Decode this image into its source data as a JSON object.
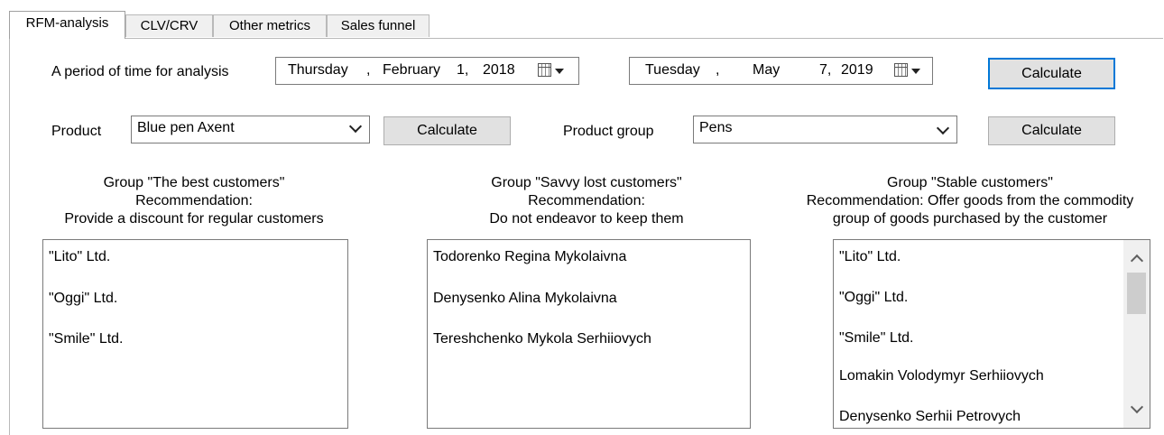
{
  "tabs": [
    {
      "label": "RFM-analysis",
      "active": true
    },
    {
      "label": "CLV/CRV",
      "active": false
    },
    {
      "label": "Other metrics",
      "active": false
    },
    {
      "label": "Sales funnel",
      "active": false
    }
  ],
  "period": {
    "label": "A period of time for analysis",
    "from": {
      "weekday": "Thursday",
      "sep": ",",
      "month": "February",
      "day": "1,",
      "year": "2018"
    },
    "to": {
      "weekday": "Tuesday",
      "sep": ",",
      "month": "May",
      "day": "7,",
      "year": "2019"
    },
    "calculate_label": "Calculate"
  },
  "product": {
    "label": "Product",
    "value": "Blue pen Axent",
    "calculate_label": "Calculate"
  },
  "product_group": {
    "label": "Product group",
    "value": "Pens",
    "calculate_label": "Calculate"
  },
  "groups": [
    {
      "line1": "Group \"The best customers\"",
      "line2": "Recommendation:",
      "line3": "Provide a discount for regular customers",
      "items": [
        "\"Lito\" Ltd.",
        "\"Oggi\" Ltd.",
        "\"Smile\" Ltd."
      ]
    },
    {
      "line1": "Group \"Savvy lost customers\"",
      "line2": "Recommendation:",
      "line3": "Do not endeavor to keep them",
      "items": [
        "Todorenko Regina Mykolaivna",
        "Denysenko Alina Mykolaivna",
        "Tereshchenko Mykola Serhiiovych"
      ]
    },
    {
      "line1": "Group \"Stable customers\"",
      "line2": "Recommendation: Offer goods from the commodity",
      "line3": "group of goods purchased by the customer",
      "items": [
        "\"Lito\" Ltd.",
        "\"Oggi\" Ltd.",
        "\"Smile\" Ltd.",
        "Lomakin Volodymyr Serhiiovych",
        "Denysenko Serhii Petrovych"
      ]
    }
  ]
}
